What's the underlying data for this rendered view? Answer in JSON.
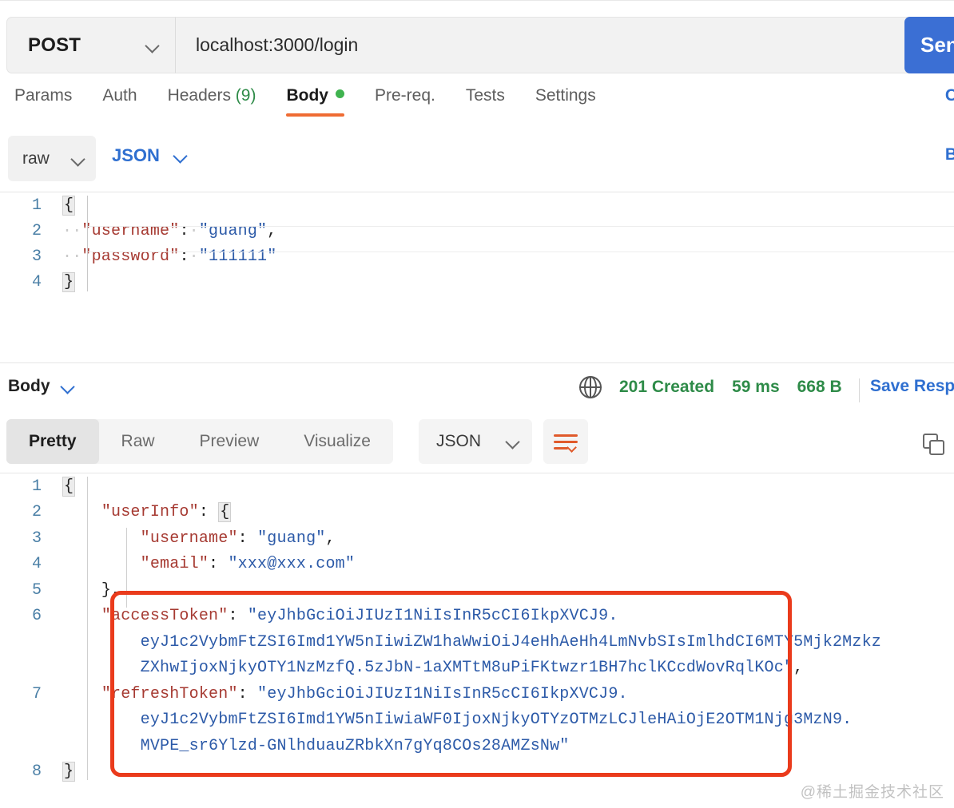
{
  "request": {
    "method": "POST",
    "url": "localhost:3000/login",
    "send_label": "Send",
    "tabs": [
      {
        "label": "Params",
        "active": false
      },
      {
        "label": "Auth",
        "active": false
      },
      {
        "label": "Headers",
        "count": "(9)",
        "active": false
      },
      {
        "label": "Body",
        "dot": true,
        "active": true
      },
      {
        "label": "Pre-req.",
        "active": false
      },
      {
        "label": "Tests",
        "active": false
      },
      {
        "label": "Settings",
        "active": false
      }
    ],
    "cookies_link": "C",
    "body_type": "raw",
    "body_format": "JSON",
    "beautify_link": "B",
    "body_lines": [
      {
        "n": "1",
        "tokens": [
          {
            "t": "{",
            "c": "brace"
          }
        ]
      },
      {
        "n": "2",
        "tokens": [
          {
            "t": "··",
            "c": "dot"
          },
          {
            "t": "\"username\"",
            "c": "k"
          },
          {
            "t": ":",
            "c": "p"
          },
          {
            "t": "·",
            "c": "dot"
          },
          {
            "t": "\"guang\"",
            "c": "s"
          },
          {
            "t": ",",
            "c": "p"
          }
        ]
      },
      {
        "n": "3",
        "tokens": [
          {
            "t": "··",
            "c": "dot"
          },
          {
            "t": "\"password\"",
            "c": "k"
          },
          {
            "t": ":",
            "c": "p"
          },
          {
            "t": "·",
            "c": "dot"
          },
          {
            "t": "\"111111\"",
            "c": "s"
          }
        ]
      },
      {
        "n": "4",
        "tokens": [
          {
            "t": "}",
            "c": "brace"
          }
        ]
      }
    ]
  },
  "response": {
    "body_label": "Body",
    "status": "201 Created",
    "time": "59 ms",
    "size": "668 B",
    "save_response": "Save Resp",
    "view_tabs": [
      {
        "label": "Pretty",
        "active": true
      },
      {
        "label": "Raw",
        "active": false
      },
      {
        "label": "Preview",
        "active": false
      },
      {
        "label": "Visualize",
        "active": false
      }
    ],
    "format": "JSON",
    "body_lines": [
      {
        "n": "1",
        "indent": 0,
        "tokens": [
          {
            "t": "{",
            "c": "brace"
          }
        ]
      },
      {
        "n": "2",
        "indent": 1,
        "tokens": [
          {
            "t": "\"userInfo\"",
            "c": "k"
          },
          {
            "t": ": ",
            "c": "p"
          },
          {
            "t": "{",
            "c": "brace"
          }
        ]
      },
      {
        "n": "3",
        "indent": 2,
        "tokens": [
          {
            "t": "\"username\"",
            "c": "k"
          },
          {
            "t": ": ",
            "c": "p"
          },
          {
            "t": "\"guang\"",
            "c": "s"
          },
          {
            "t": ",",
            "c": "p"
          }
        ]
      },
      {
        "n": "4",
        "indent": 2,
        "tokens": [
          {
            "t": "\"email\"",
            "c": "k"
          },
          {
            "t": ": ",
            "c": "p"
          },
          {
            "t": "\"xxx@xxx.com\"",
            "c": "s"
          }
        ]
      },
      {
        "n": "5",
        "indent": 1,
        "tokens": [
          {
            "t": "}",
            "c": "p"
          },
          {
            "t": ",",
            "c": "p"
          }
        ]
      },
      {
        "n": "6",
        "indent": 1,
        "tokens": [
          {
            "t": "\"accessToken\"",
            "c": "k"
          },
          {
            "t": ": ",
            "c": "p"
          },
          {
            "t": "\"eyJhbGciOiJIUzI1NiIsInR5cCI6IkpXVCJ9.",
            "c": "s"
          }
        ]
      },
      {
        "n": "",
        "indent": 2,
        "tokens": [
          {
            "t": "eyJ1c2VybmFtZSI6Imd1YW5nIiwiZW1haWwiOiJ4eHhAeHh4LmNvbSIsImlhdCI6MTY5Mjk2Mzkz",
            "c": "s"
          }
        ]
      },
      {
        "n": "",
        "indent": 2,
        "tokens": [
          {
            "t": "ZXhwIjoxNjkyOTY1NzMzfQ.5zJbN-1aXMTtM8uPiFKtwzr1BH7hclKCcdWovRqlKOc\"",
            "c": "s"
          },
          {
            "t": ",",
            "c": "p"
          }
        ]
      },
      {
        "n": "7",
        "indent": 1,
        "tokens": [
          {
            "t": "\"refreshToken\"",
            "c": "k"
          },
          {
            "t": ": ",
            "c": "p"
          },
          {
            "t": "\"eyJhbGciOiJIUzI1NiIsInR5cCI6IkpXVCJ9.",
            "c": "s"
          }
        ]
      },
      {
        "n": "",
        "indent": 2,
        "tokens": [
          {
            "t": "eyJ1c2VybmFtZSI6Imd1YW5nIiwiaWF0IjoxNjkyOTYzOTMzLCJleHAiOjE2OTM1Njg3MzN9.",
            "c": "s"
          }
        ]
      },
      {
        "n": "",
        "indent": 2,
        "tokens": [
          {
            "t": "MVPE_sr6Ylzd-GNlhduauZRbkXn7gYq8COs28AMZsNw\"",
            "c": "s"
          }
        ]
      },
      {
        "n": "8",
        "indent": 0,
        "tokens": [
          {
            "t": "}",
            "c": "brace"
          }
        ]
      }
    ],
    "annotation_color": "#ea3b1c"
  },
  "watermark": "@稀土掘金技术社区"
}
